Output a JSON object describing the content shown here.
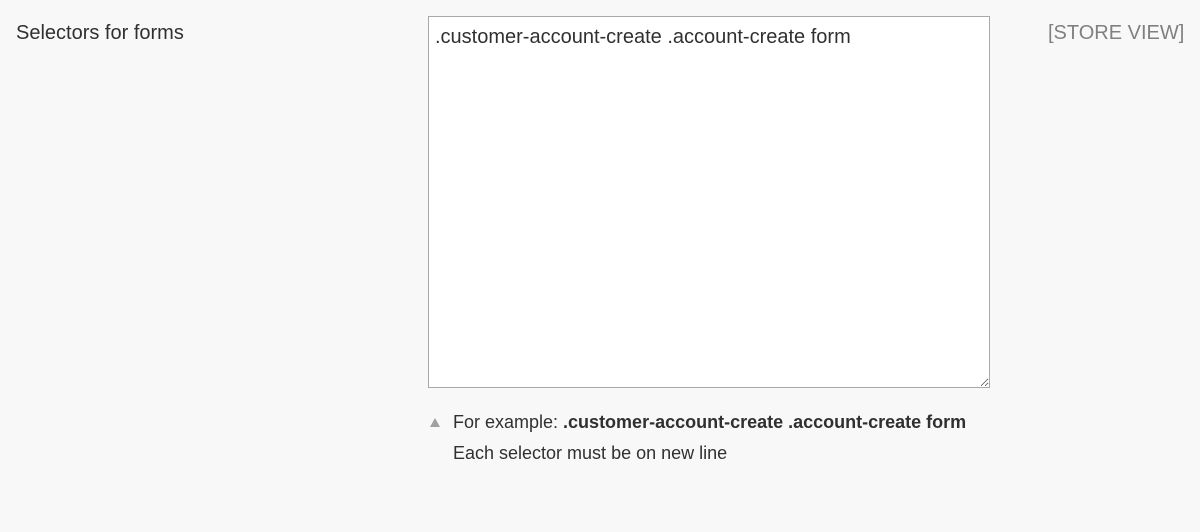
{
  "field": {
    "label": "Selectors for forms",
    "value": ".customer-account-create .account-create form",
    "note": {
      "example_prefix": "For example: ",
      "example_value": ".customer-account-create .account-create form",
      "instruction": "Each selector must be on new line"
    },
    "scope": "[STORE VIEW]"
  },
  "icons": {
    "note_icon": "triangle-up-icon"
  },
  "colors": {
    "background": "#f8f8f8",
    "text": "#303030",
    "scope_text": "#808080",
    "input_border": "#a9a9a9",
    "note_icon": "#a0a0a0"
  }
}
